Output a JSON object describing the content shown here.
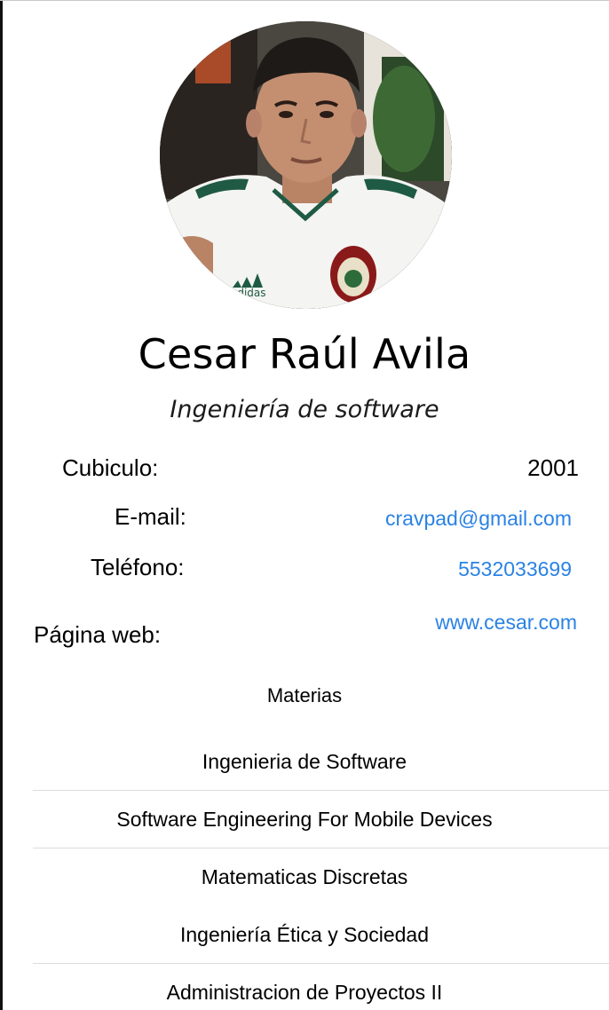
{
  "profile": {
    "name": "Cesar Raúl Avila",
    "career": "Ingeniería de software",
    "photo_icon": "profile-photo"
  },
  "details": {
    "cubiculo_label": "Cubiculo:",
    "cubiculo_value": "2001",
    "email_label": "E-mail:",
    "email_value": "cravpad@gmail.com",
    "telefono_label": "Teléfono:",
    "telefono_value": "5532033699",
    "web_label": "Página web:",
    "web_value": "www.cesar.com"
  },
  "subjects": {
    "title": "Materias",
    "items": [
      {
        "label": "Ingenieria de Software"
      },
      {
        "label": "Software Engineering For Mobile Devices"
      },
      {
        "label": "Matematicas Discretas"
      },
      {
        "label": "Ingeniería Ética y Sociedad"
      },
      {
        "label": "Administracion de Proyectos II"
      }
    ]
  },
  "colors": {
    "link": "#2a82e4",
    "text": "#000000",
    "separator": "#dcdcdc"
  }
}
